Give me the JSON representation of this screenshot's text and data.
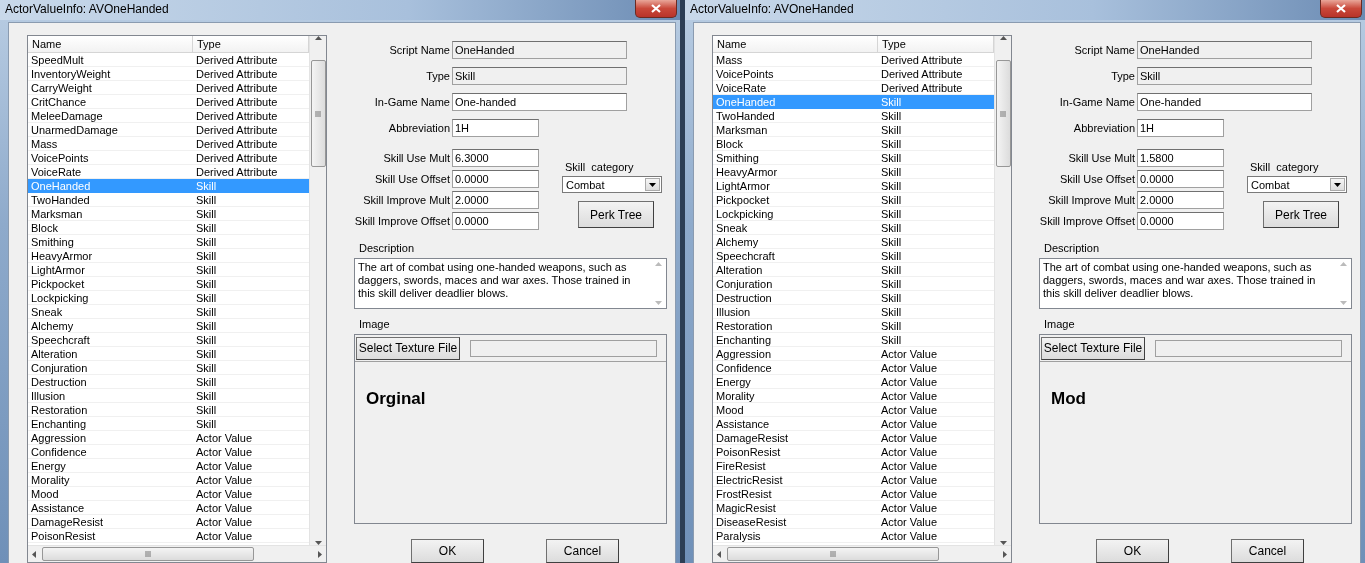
{
  "windows": [
    {
      "title": "ActorValueInfo: AVOneHanded",
      "list": {
        "columns": [
          "Name",
          "Type"
        ],
        "rows": [
          {
            "name": "SpeedMult",
            "type": "Derived Attribute",
            "selected": false
          },
          {
            "name": "InventoryWeight",
            "type": "Derived Attribute",
            "selected": false
          },
          {
            "name": "CarryWeight",
            "type": "Derived Attribute",
            "selected": false
          },
          {
            "name": "CritChance",
            "type": "Derived Attribute",
            "selected": false
          },
          {
            "name": "MeleeDamage",
            "type": "Derived Attribute",
            "selected": false
          },
          {
            "name": "UnarmedDamage",
            "type": "Derived Attribute",
            "selected": false
          },
          {
            "name": "Mass",
            "type": "Derived Attribute",
            "selected": false
          },
          {
            "name": "VoicePoints",
            "type": "Derived Attribute",
            "selected": false
          },
          {
            "name": "VoiceRate",
            "type": "Derived Attribute",
            "selected": false
          },
          {
            "name": "OneHanded",
            "type": "Skill",
            "selected": true
          },
          {
            "name": "TwoHanded",
            "type": "Skill",
            "selected": false
          },
          {
            "name": "Marksman",
            "type": "Skill",
            "selected": false
          },
          {
            "name": "Block",
            "type": "Skill",
            "selected": false
          },
          {
            "name": "Smithing",
            "type": "Skill",
            "selected": false
          },
          {
            "name": "HeavyArmor",
            "type": "Skill",
            "selected": false
          },
          {
            "name": "LightArmor",
            "type": "Skill",
            "selected": false
          },
          {
            "name": "Pickpocket",
            "type": "Skill",
            "selected": false
          },
          {
            "name": "Lockpicking",
            "type": "Skill",
            "selected": false
          },
          {
            "name": "Sneak",
            "type": "Skill",
            "selected": false
          },
          {
            "name": "Alchemy",
            "type": "Skill",
            "selected": false
          },
          {
            "name": "Speechcraft",
            "type": "Skill",
            "selected": false
          },
          {
            "name": "Alteration",
            "type": "Skill",
            "selected": false
          },
          {
            "name": "Conjuration",
            "type": "Skill",
            "selected": false
          },
          {
            "name": "Destruction",
            "type": "Skill",
            "selected": false
          },
          {
            "name": "Illusion",
            "type": "Skill",
            "selected": false
          },
          {
            "name": "Restoration",
            "type": "Skill",
            "selected": false
          },
          {
            "name": "Enchanting",
            "type": "Skill",
            "selected": false
          },
          {
            "name": "Aggression",
            "type": "Actor Value",
            "selected": false
          },
          {
            "name": "Confidence",
            "type": "Actor Value",
            "selected": false
          },
          {
            "name": "Energy",
            "type": "Actor Value",
            "selected": false
          },
          {
            "name": "Morality",
            "type": "Actor Value",
            "selected": false
          },
          {
            "name": "Mood",
            "type": "Actor Value",
            "selected": false
          },
          {
            "name": "Assistance",
            "type": "Actor Value",
            "selected": false
          },
          {
            "name": "DamageResist",
            "type": "Actor Value",
            "selected": false
          },
          {
            "name": "PoisonResist",
            "type": "Actor Value",
            "selected": false
          }
        ]
      },
      "fields": [
        {
          "label": "Script Name",
          "value": "OneHanded",
          "disabled": true
        },
        {
          "label": "Type",
          "value": "Skill",
          "disabled": true
        },
        {
          "label": "In-Game Name",
          "value": "One-handed",
          "disabled": false
        },
        {
          "label": "Abbreviation",
          "value": "1H",
          "disabled": false
        }
      ],
      "skill_fields": [
        {
          "label": "Skill Use Mult",
          "value": "6.3000"
        },
        {
          "label": "Skill Use Offset",
          "value": "0.0000"
        },
        {
          "label": "Skill Improve Mult",
          "value": "2.0000"
        },
        {
          "label": "Skill Improve Offset",
          "value": "0.0000"
        }
      ],
      "skill_category": {
        "label": "Skill  category",
        "value": "Combat"
      },
      "perk_tree_button": "Perk Tree",
      "description": {
        "label": "Description",
        "text": "The art of combat using one-handed weapons, such as daggers, swords, maces and war axes. Those trained in this skill deliver deadlier blows."
      },
      "image": {
        "label": "Image",
        "button": "Select Texture File",
        "caption": "Orginal"
      },
      "buttons": [
        "OK",
        "Cancel"
      ]
    },
    {
      "title": "ActorValueInfo: AVOneHanded",
      "list": {
        "columns": [
          "Name",
          "Type"
        ],
        "rows": [
          {
            "name": "Mass",
            "type": "Derived Attribute",
            "selected": false
          },
          {
            "name": "VoicePoints",
            "type": "Derived Attribute",
            "selected": false
          },
          {
            "name": "VoiceRate",
            "type": "Derived Attribute",
            "selected": false
          },
          {
            "name": "OneHanded",
            "type": "Skill",
            "selected": true
          },
          {
            "name": "TwoHanded",
            "type": "Skill",
            "selected": false
          },
          {
            "name": "Marksman",
            "type": "Skill",
            "selected": false
          },
          {
            "name": "Block",
            "type": "Skill",
            "selected": false
          },
          {
            "name": "Smithing",
            "type": "Skill",
            "selected": false
          },
          {
            "name": "HeavyArmor",
            "type": "Skill",
            "selected": false
          },
          {
            "name": "LightArmor",
            "type": "Skill",
            "selected": false
          },
          {
            "name": "Pickpocket",
            "type": "Skill",
            "selected": false
          },
          {
            "name": "Lockpicking",
            "type": "Skill",
            "selected": false
          },
          {
            "name": "Sneak",
            "type": "Skill",
            "selected": false
          },
          {
            "name": "Alchemy",
            "type": "Skill",
            "selected": false
          },
          {
            "name": "Speechcraft",
            "type": "Skill",
            "selected": false
          },
          {
            "name": "Alteration",
            "type": "Skill",
            "selected": false
          },
          {
            "name": "Conjuration",
            "type": "Skill",
            "selected": false
          },
          {
            "name": "Destruction",
            "type": "Skill",
            "selected": false
          },
          {
            "name": "Illusion",
            "type": "Skill",
            "selected": false
          },
          {
            "name": "Restoration",
            "type": "Skill",
            "selected": false
          },
          {
            "name": "Enchanting",
            "type": "Skill",
            "selected": false
          },
          {
            "name": "Aggression",
            "type": "Actor Value",
            "selected": false
          },
          {
            "name": "Confidence",
            "type": "Actor Value",
            "selected": false
          },
          {
            "name": "Energy",
            "type": "Actor Value",
            "selected": false
          },
          {
            "name": "Morality",
            "type": "Actor Value",
            "selected": false
          },
          {
            "name": "Mood",
            "type": "Actor Value",
            "selected": false
          },
          {
            "name": "Assistance",
            "type": "Actor Value",
            "selected": false
          },
          {
            "name": "DamageResist",
            "type": "Actor Value",
            "selected": false
          },
          {
            "name": "PoisonResist",
            "type": "Actor Value",
            "selected": false
          },
          {
            "name": "FireResist",
            "type": "Actor Value",
            "selected": false
          },
          {
            "name": "ElectricResist",
            "type": "Actor Value",
            "selected": false
          },
          {
            "name": "FrostResist",
            "type": "Actor Value",
            "selected": false
          },
          {
            "name": "MagicResist",
            "type": "Actor Value",
            "selected": false
          },
          {
            "name": "DiseaseResist",
            "type": "Actor Value",
            "selected": false
          },
          {
            "name": "Paralysis",
            "type": "Actor Value",
            "selected": false
          }
        ]
      },
      "fields": [
        {
          "label": "Script Name",
          "value": "OneHanded",
          "disabled": true
        },
        {
          "label": "Type",
          "value": "Skill",
          "disabled": true
        },
        {
          "label": "In-Game Name",
          "value": "One-handed",
          "disabled": false
        },
        {
          "label": "Abbreviation",
          "value": "1H",
          "disabled": false
        }
      ],
      "skill_fields": [
        {
          "label": "Skill Use Mult",
          "value": "1.5800"
        },
        {
          "label": "Skill Use Offset",
          "value": "0.0000"
        },
        {
          "label": "Skill Improve Mult",
          "value": "2.0000"
        },
        {
          "label": "Skill Improve Offset",
          "value": "0.0000"
        }
      ],
      "skill_category": {
        "label": "Skill  category",
        "value": "Combat"
      },
      "perk_tree_button": "Perk Tree",
      "description": {
        "label": "Description",
        "text": "The art of combat using one-handed weapons, such as daggers, swords, maces and war axes. Those trained in this skill deliver deadlier blows."
      },
      "image": {
        "label": "Image",
        "button": "Select Texture File",
        "caption": "Mod"
      },
      "buttons": [
        "OK",
        "Cancel"
      ]
    }
  ]
}
